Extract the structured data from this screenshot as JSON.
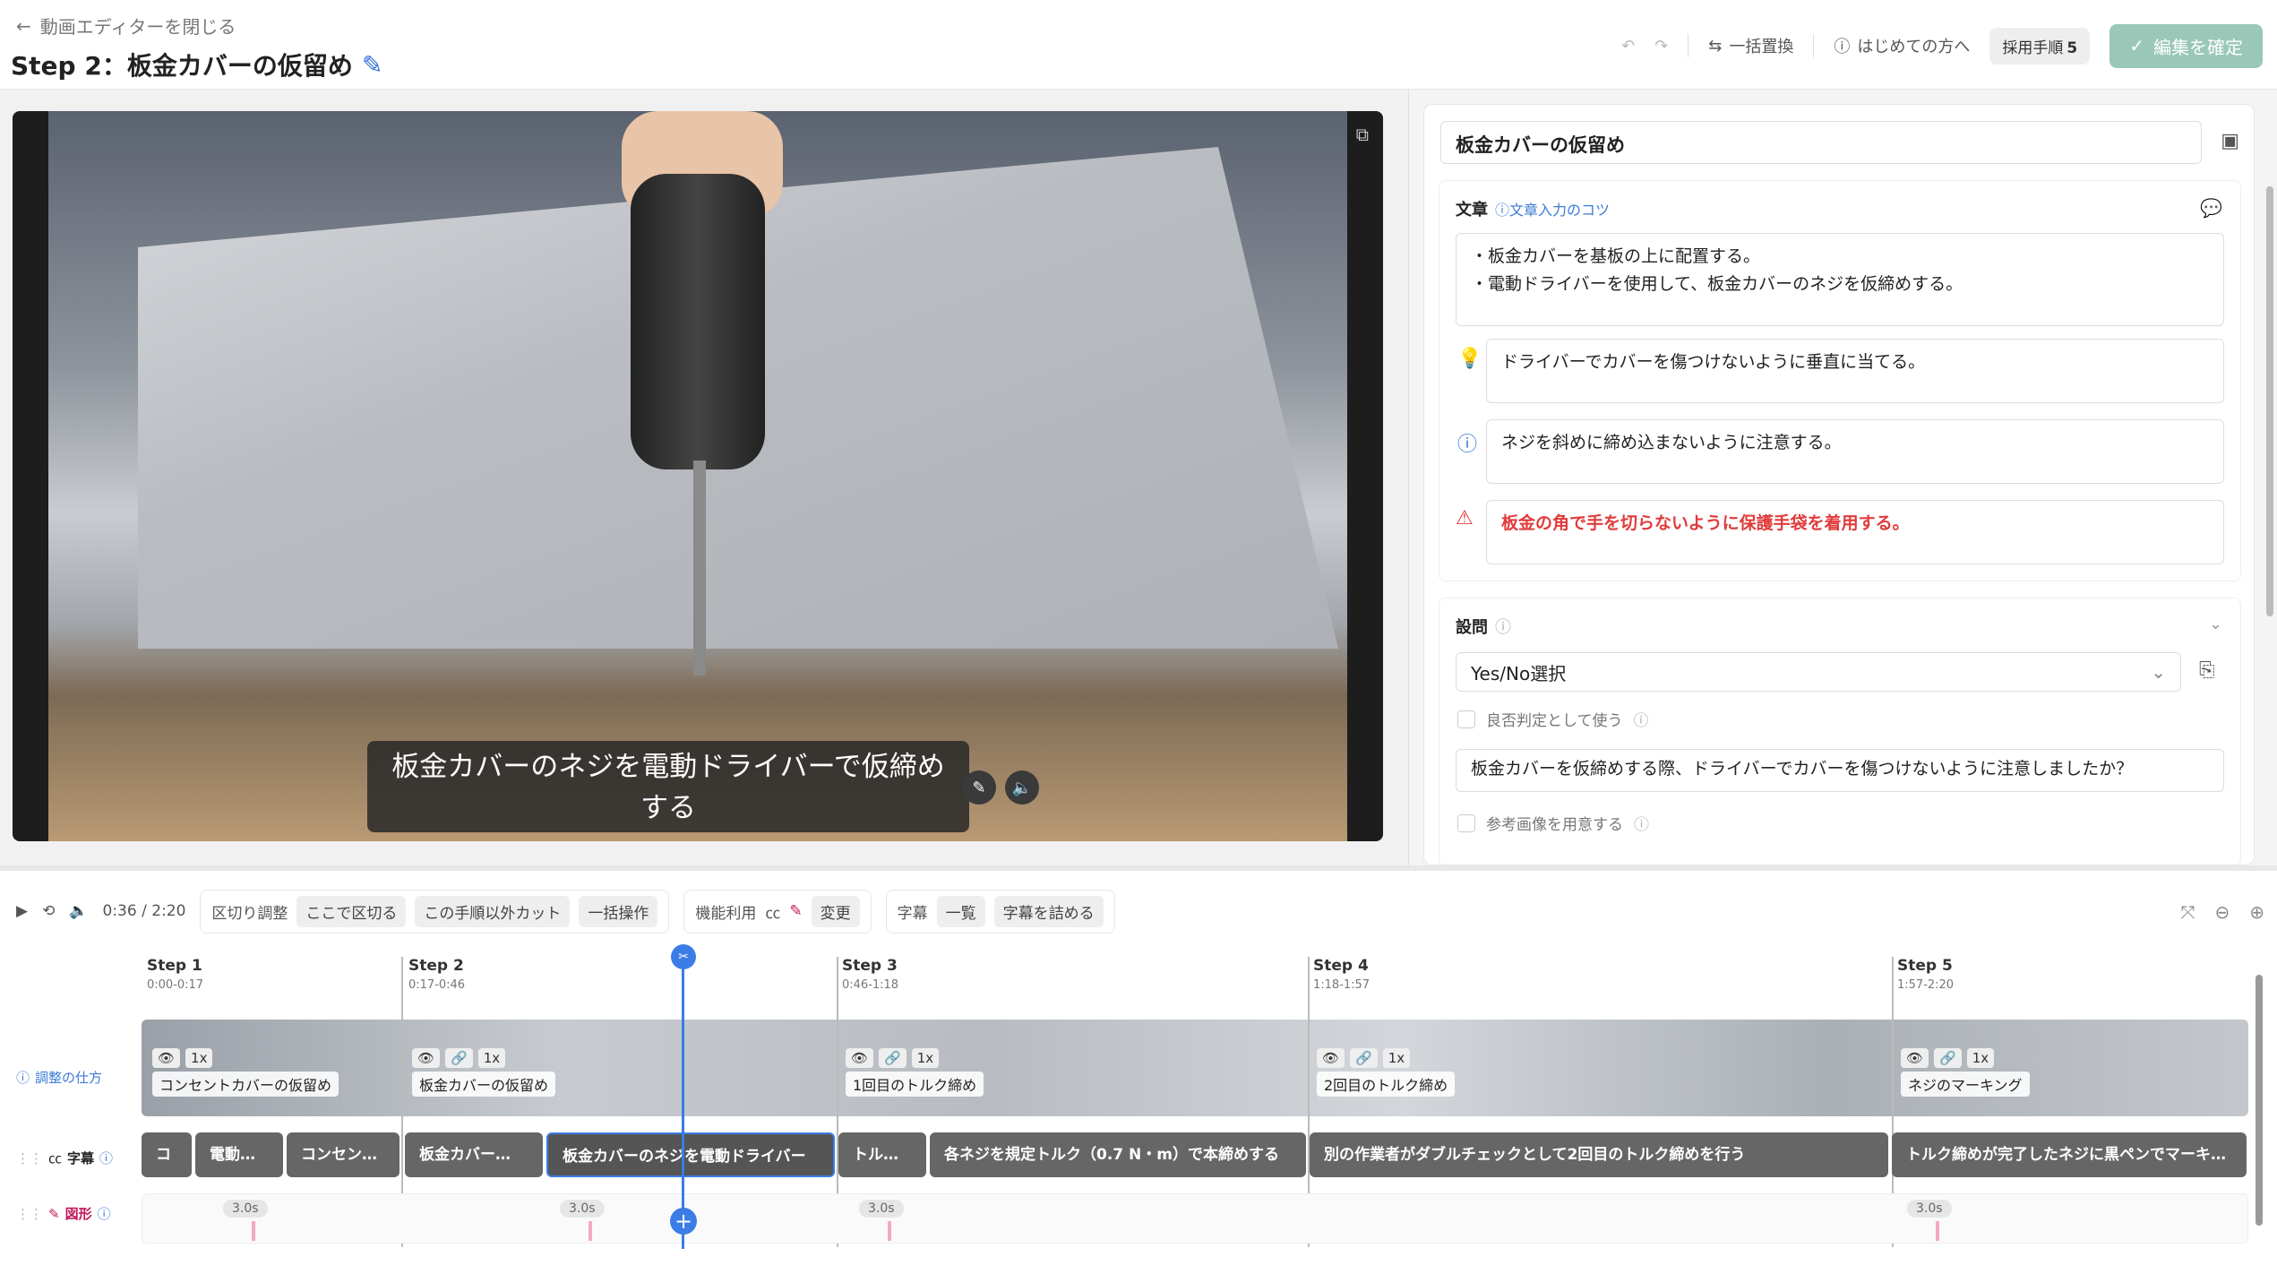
{
  "header": {
    "back_label": "動画エディターを閉じる",
    "title": "Step 2：板金カバーの仮留め",
    "bulk_replace": "一括置換",
    "first_time": "はじめての方へ",
    "adopted_label": "採用手順",
    "adopted_count": "5",
    "confirm": "編集を確定"
  },
  "video": {
    "caption": "板金カバーのネジを電動ドライバーで仮締めする"
  },
  "panel": {
    "step_title": "板金カバーの仮留め",
    "text_label": "文章",
    "text_tips": "文章入力のコツ",
    "body_lines": [
      "・板金カバーを基板の上に配置する。",
      "・電動ドライバーを使用して、板金カバーのネジを仮締めする。"
    ],
    "hint": "ドライバーでカバーを傷つけないように垂直に当てる。",
    "info": "ネジを斜めに締め込まないように注意する。",
    "warning": "板金の角で手を切らないように保護手袋を着用する。",
    "question_label": "設問",
    "question_type": "Yes/No選択",
    "pass_fail": "良否判定として使う",
    "question_text": "板金カバーを仮締めする際、ドライバーでカバーを傷つけないように注意しましたか？",
    "ref_image": "参考画像を用意する"
  },
  "toolbar": {
    "time": "0:36 / 2:20",
    "cut_adjust": "区切り調整",
    "cut_here": "ここで区切る",
    "cut_others": "この手順以外カット",
    "bulk_ops": "一括操作",
    "feature_use": "機能利用",
    "change": "変更",
    "subtitle": "字幕",
    "list": "一覧",
    "compact": "字幕を詰める"
  },
  "timeline": {
    "adjust_help": "調整の仕方",
    "sub_label": "字幕",
    "shape_label": "図形",
    "steps": [
      {
        "name": "Step 1",
        "range": "0:00-0:17",
        "title": "コンセントカバーの仮留め",
        "speed": "1x"
      },
      {
        "name": "Step 2",
        "range": "0:17-0:46",
        "title": "板金カバーの仮留め",
        "speed": "1x"
      },
      {
        "name": "Step 3",
        "range": "0:46-1:18",
        "title": "1回目のトルク締め",
        "speed": "1x"
      },
      {
        "name": "Step 4",
        "range": "1:18-1:57",
        "title": "2回目のトルク締め",
        "speed": "1x"
      },
      {
        "name": "Step 5",
        "range": "1:57-2:20",
        "title": "ネジのマーキング",
        "speed": "1x"
      }
    ],
    "subtitles": [
      "コ",
      "電動…",
      "コンセン…",
      "板金カバー…",
      "板金カバーのネジを電動ドライバー",
      "トル…",
      "各ネジを規定トルク（0.7 N・m）で本締めする",
      "別の作業者がダブルチェックとして2回目のトルク締めを行う",
      "トルク締めが完了したネジに黒ペンでマーキ…"
    ],
    "shape_duration": "3.0s"
  }
}
